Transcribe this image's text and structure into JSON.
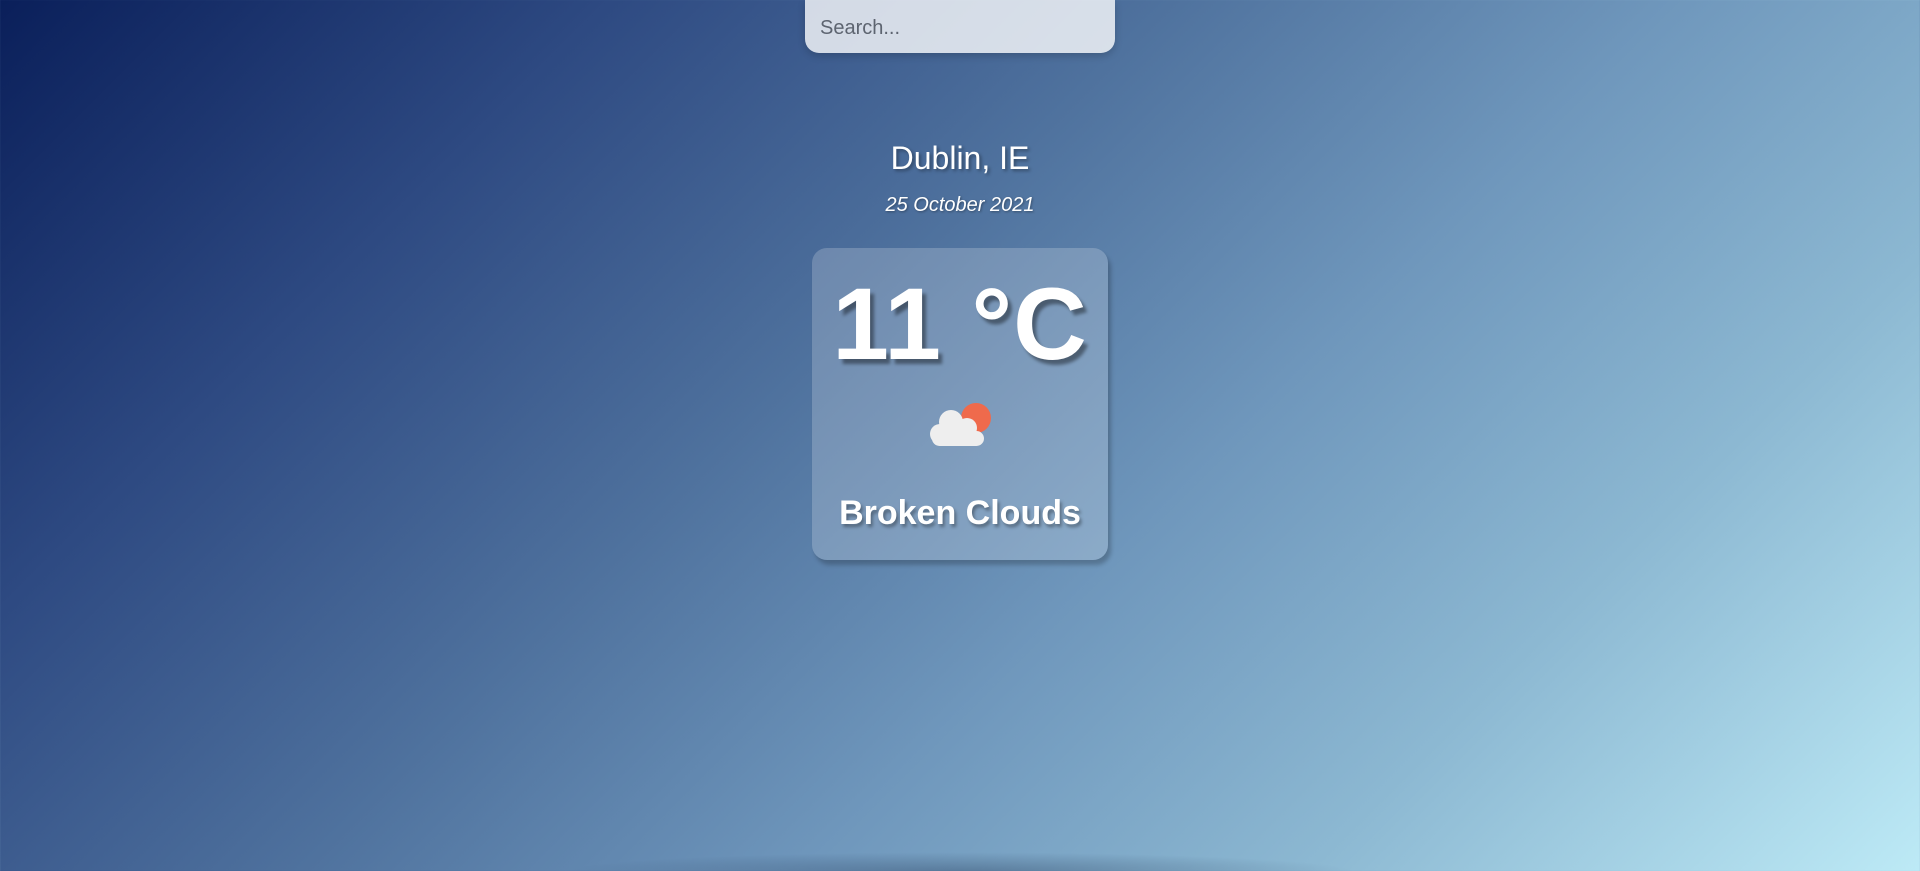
{
  "search": {
    "placeholder": "Search...",
    "value": ""
  },
  "location": {
    "city_country": "Dublin, IE",
    "date": "25 October 2021"
  },
  "weather": {
    "temperature": "11 °C",
    "condition": "Broken Clouds",
    "icon": "partly-cloudy-icon"
  },
  "colors": {
    "gradient_start": "#0a1f5a",
    "gradient_end": "#bdeaf6",
    "sun": "#ef6a4c",
    "cloud": "#eeeeee"
  }
}
